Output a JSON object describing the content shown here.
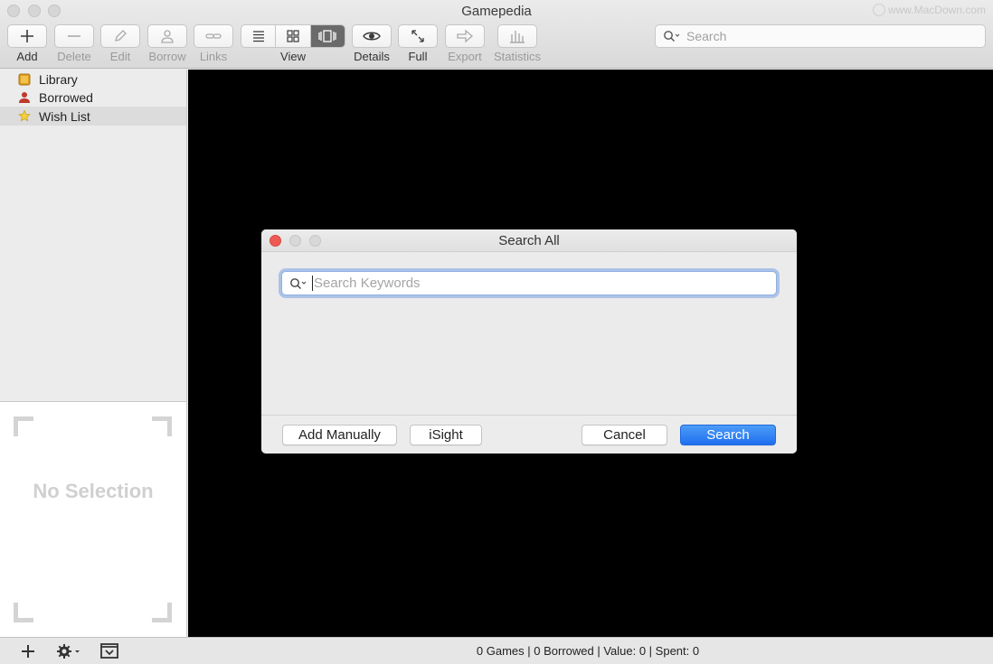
{
  "window": {
    "title": "Gamepedia",
    "watermark": "www.MacDown.com"
  },
  "toolbar": {
    "add": "Add",
    "delete": "Delete",
    "edit": "Edit",
    "borrow": "Borrow",
    "links": "Links",
    "view": "View",
    "details": "Details",
    "full": "Full",
    "export": "Export",
    "statistics": "Statistics",
    "search_placeholder": "Search"
  },
  "sidebar": {
    "items": [
      {
        "label": "Library",
        "icon": "library-icon"
      },
      {
        "label": "Borrowed",
        "icon": "person-icon"
      },
      {
        "label": "Wish List",
        "icon": "star-icon",
        "selected": true
      }
    ],
    "preview_text": "No Selection"
  },
  "status": {
    "text": "0 Games | 0 Borrowed | Value: 0 | Spent: 0"
  },
  "dialog": {
    "title": "Search All",
    "keywords_placeholder": "Search Keywords",
    "keywords_value": "",
    "add_manually": "Add Manually",
    "isight": "iSight",
    "cancel": "Cancel",
    "search": "Search"
  },
  "colors": {
    "accent": "#1f6ff0",
    "close": "#ee5a52",
    "content_bg": "#000000"
  }
}
